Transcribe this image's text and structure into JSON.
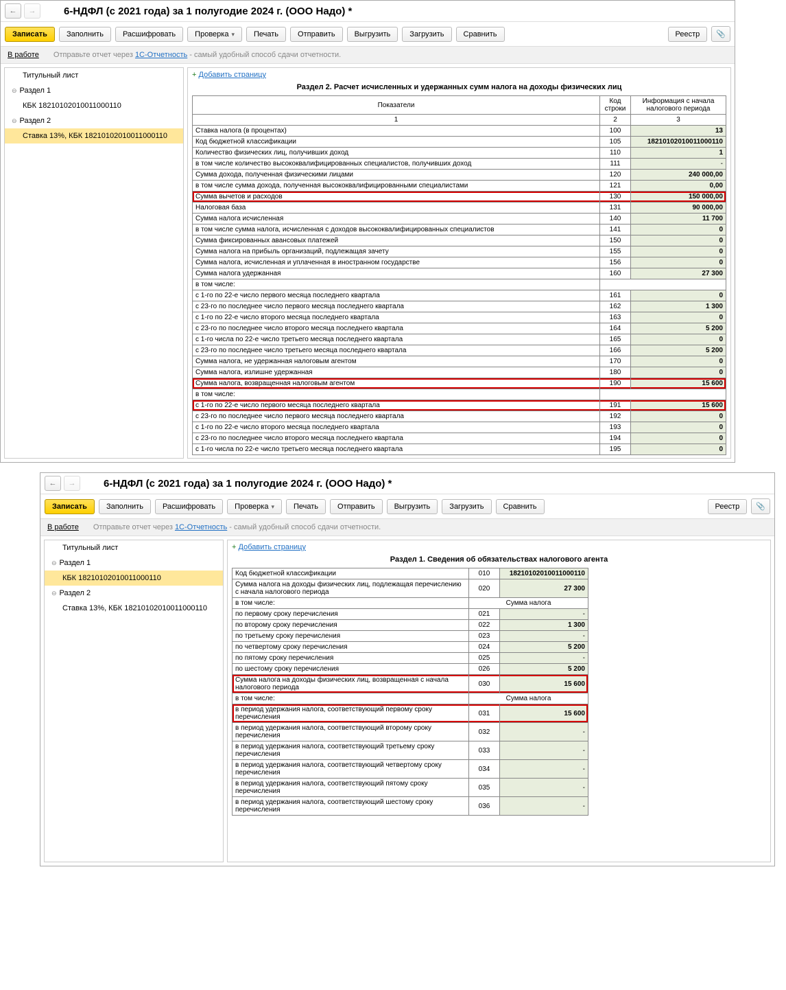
{
  "title": "6-НДФЛ (с 2021 года) за 1 полугодие 2024 г. (ООО Надо) *",
  "toolbar": {
    "write": "Записать",
    "fill": "Заполнить",
    "decode": "Расшифровать",
    "check": "Проверка",
    "print": "Печать",
    "send": "Отправить",
    "unload": "Выгрузить",
    "load": "Загрузить",
    "compare": "Сравнить",
    "registry": "Реестр"
  },
  "info": {
    "status": "В работе",
    "text1": "Отправьте отчет через ",
    "link": "1С-Отчетность",
    "text2": " - самый удобный способ сдачи отчетности."
  },
  "tree": {
    "titlepage": "Титульный лист",
    "s1": "Раздел 1",
    "s1kbk": "КБК 18210102010011000110",
    "s2": "Раздел 2",
    "s2rate": "Ставка 13%, КБК 18210102010011000110"
  },
  "addpage": {
    "plus": "+",
    "label": "Добавить страницу"
  },
  "section2": {
    "title": "Раздел 2. Расчет исчисленных и удержанных сумм налога на доходы физических лиц",
    "headers": {
      "ind": "Показатели",
      "code": "Код строки",
      "info": "Информация с начала налогового периода"
    },
    "subheaders": {
      "c1": "1",
      "c2": "2",
      "c3": "3"
    },
    "rows": [
      {
        "l": "Ставка налога (в процентах)",
        "c": "100",
        "v": "13",
        "bold": true
      },
      {
        "l": "Код бюджетной классификации",
        "c": "105",
        "v": "18210102010011000110",
        "bold": true
      },
      {
        "l": "Количество физических лиц, получивших доход",
        "c": "110",
        "v": "1",
        "bold": true
      },
      {
        "l": "в том числе количество высококвалифицированных специалистов, получивших доход",
        "c": "111",
        "v": "-",
        "ind": 1
      },
      {
        "l": "Сумма дохода, полученная физическими лицами",
        "c": "120",
        "v": "240 000,00",
        "bold": true
      },
      {
        "l": "в том числе сумма дохода, полученная высококвалифицированными специалистами",
        "c": "121",
        "v": "0,00",
        "bold": true,
        "ind": 1
      },
      {
        "l": "Сумма вычетов и расходов",
        "c": "130",
        "v": "150 000,00",
        "bold": true,
        "hi": true
      },
      {
        "l": "Налоговая база",
        "c": "131",
        "v": "90 000,00",
        "bold": true
      },
      {
        "l": "Сумма налога исчисленная",
        "c": "140",
        "v": "11 700",
        "bold": true
      },
      {
        "l": "в том числе сумма налога, исчисленная с доходов высококвалифицированных специалистов",
        "c": "141",
        "v": "0",
        "bold": true,
        "ind": 1
      },
      {
        "l": "Сумма фиксированных авансовых платежей",
        "c": "150",
        "v": "0",
        "bold": true
      },
      {
        "l": "Сумма налога на прибыль организаций, подлежащая зачету",
        "c": "155",
        "v": "0",
        "bold": true
      },
      {
        "l": "Сумма налога, исчисленная и уплаченная в иностранном государстве",
        "c": "156",
        "v": "0",
        "bold": true
      },
      {
        "l": "Сумма налога удержанная",
        "c": "160",
        "v": "27 300",
        "bold": true
      },
      {
        "l": "в том числе:",
        "nc": true,
        "ind": 1
      },
      {
        "l": "с 1-го по 22-е число первого месяца последнего квартала",
        "c": "161",
        "v": "0",
        "bold": true,
        "ind": 1
      },
      {
        "l": "с 23-го по последнее число первого месяца последнего квартала",
        "c": "162",
        "v": "1 300",
        "bold": true,
        "ind": 1
      },
      {
        "l": "с 1-го по 22-е число второго месяца последнего квартала",
        "c": "163",
        "v": "0",
        "bold": true,
        "ind": 1
      },
      {
        "l": "с 23-го по последнее число второго месяца последнего квартала",
        "c": "164",
        "v": "5 200",
        "bold": true,
        "ind": 1
      },
      {
        "l": "с 1-го числа по 22-е число третьего месяца последнего квартала",
        "c": "165",
        "v": "0",
        "bold": true,
        "ind": 1
      },
      {
        "l": "с 23-го по последнее число третьего месяца последнего квартала",
        "c": "166",
        "v": "5 200",
        "bold": true,
        "ind": 1
      },
      {
        "l": "Сумма налога, не удержанная налоговым агентом",
        "c": "170",
        "v": "0",
        "bold": true
      },
      {
        "l": "Сумма налога, излишне удержанная",
        "c": "180",
        "v": "0",
        "bold": true
      },
      {
        "l": "Сумма налога, возвращенная налоговым агентом",
        "c": "190",
        "v": "15 600",
        "bold": true,
        "hi": true
      },
      {
        "l": "в том числе:",
        "nc": true,
        "ind": 1
      },
      {
        "l": "с 1-го по 22-е число первого месяца последнего квартала",
        "c": "191",
        "v": "15 600",
        "bold": true,
        "ind": 1,
        "hi": true
      },
      {
        "l": "с 23-го по последнее число первого месяца последнего квартала",
        "c": "192",
        "v": "0",
        "bold": true,
        "ind": 1
      },
      {
        "l": "с 1-го по 22-е число второго месяца последнего квартала",
        "c": "193",
        "v": "0",
        "bold": true,
        "ind": 1
      },
      {
        "l": "с 23-го по последнее число второго месяца последнего квартала",
        "c": "194",
        "v": "0",
        "bold": true,
        "ind": 1
      },
      {
        "l": "с 1-го числа по 22-е число третьего месяца последнего квартала",
        "c": "195",
        "v": "0",
        "bold": true,
        "ind": 1
      }
    ]
  },
  "section1": {
    "title": "Раздел 1. Сведения об обязательствах налогового агента",
    "rows": [
      {
        "l": "Код бюджетной классификации",
        "c": "010",
        "v": "18210102010011000110",
        "bold": true
      },
      {
        "l": "Сумма налога на доходы физических лиц, подлежащая перечислению с начала налогового периода",
        "c": "020",
        "v": "27 300",
        "bold": true
      },
      {
        "l": "в том числе:",
        "merge": "Сумма налога",
        "ind": 1
      },
      {
        "l": "по первому сроку перечисления",
        "c": "021",
        "v": "-",
        "ind": 2
      },
      {
        "l": "по второму сроку перечисления",
        "c": "022",
        "v": "1 300",
        "bold": true,
        "ind": 2
      },
      {
        "l": "по третьему сроку перечисления",
        "c": "023",
        "v": "-",
        "ind": 2
      },
      {
        "l": "по четвертому сроку перечисления",
        "c": "024",
        "v": "5 200",
        "bold": true,
        "ind": 2
      },
      {
        "l": "по пятому сроку перечисления",
        "c": "025",
        "v": "-",
        "ind": 2
      },
      {
        "l": "по шестому сроку перечисления",
        "c": "026",
        "v": "5 200",
        "bold": true,
        "ind": 2
      },
      {
        "l": "Сумма налога на доходы физических лиц, возвращенная с начала налогового периода",
        "c": "030",
        "v": "15 600",
        "bold": true,
        "hi": true
      },
      {
        "l": "в том числе:",
        "merge": "Сумма налога",
        "ind": 1
      },
      {
        "l": "в период удержания налога, соответствующий первому сроку перечисления",
        "c": "031",
        "v": "15 600",
        "bold": true,
        "ind": 2,
        "hi": true
      },
      {
        "l": "в период удержания налога, соответствующий второму сроку перечисления",
        "c": "032",
        "v": "-",
        "ind": 2
      },
      {
        "l": "в период удержания налога, соответствующий третьему сроку перечисления",
        "c": "033",
        "v": "-",
        "ind": 2
      },
      {
        "l": "в период удержания налога, соответствующий четвертому сроку перечисления",
        "c": "034",
        "v": "-",
        "ind": 2
      },
      {
        "l": "в период удержания налога, соответствующий пятому сроку перечисления",
        "c": "035",
        "v": "-",
        "ind": 2
      },
      {
        "l": "в период удержания налога, соответствующий шестому сроку перечисления",
        "c": "036",
        "v": "-",
        "ind": 2
      }
    ]
  }
}
